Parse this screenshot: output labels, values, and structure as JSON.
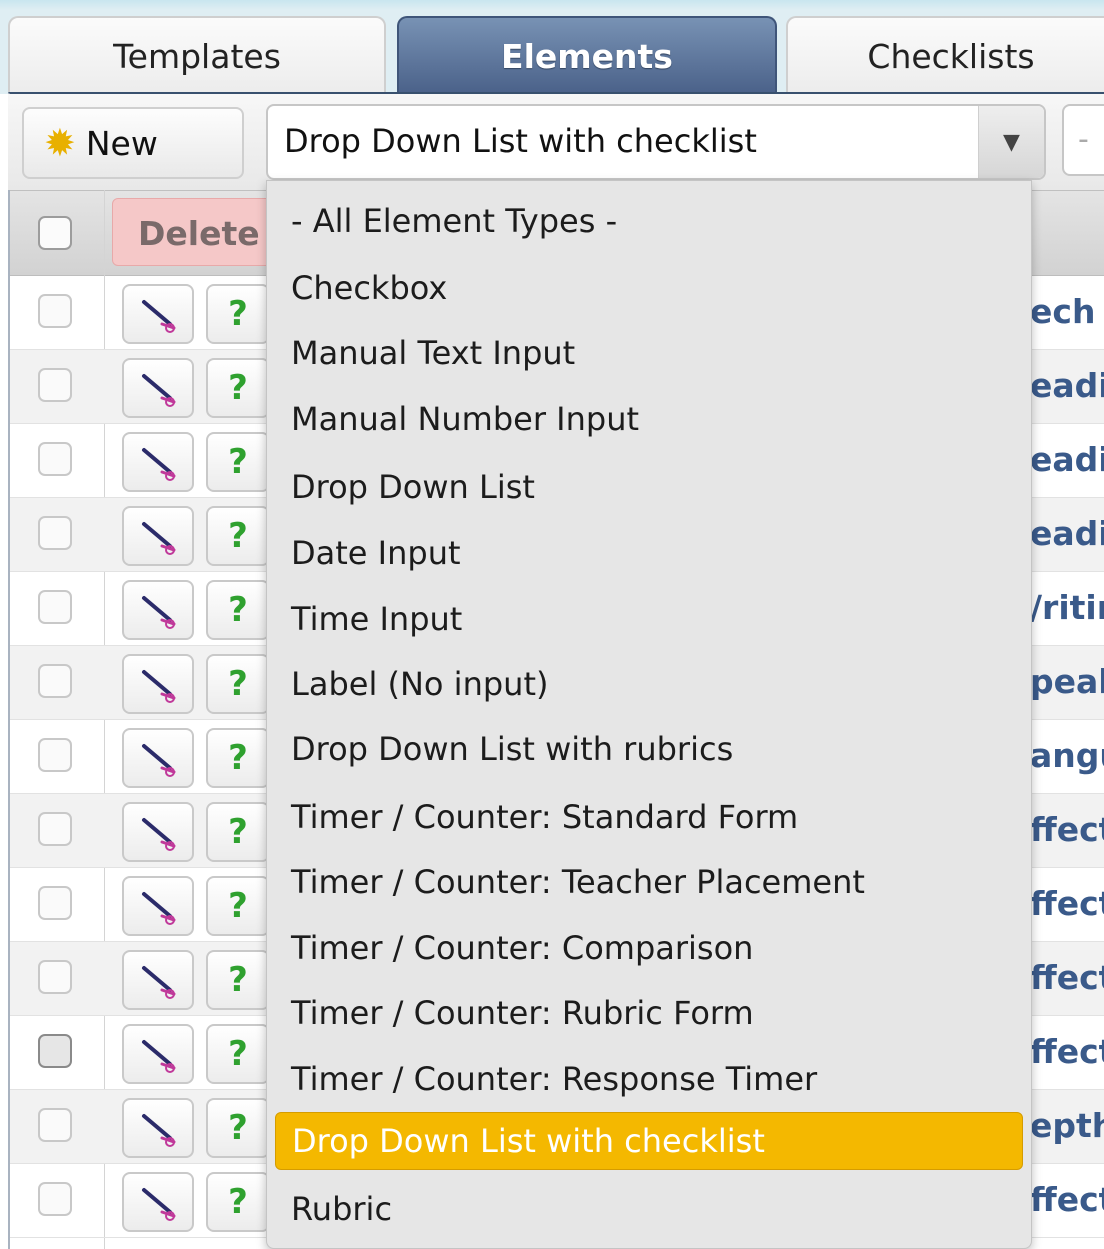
{
  "tabs": [
    {
      "label": "Templates"
    },
    {
      "label": "Elements"
    },
    {
      "label": "Checklists"
    }
  ],
  "toolbar": {
    "new_label": "New",
    "new_icon": "star-icon",
    "type_select_value": "Drop Down List with checklist",
    "second_select_value": "-"
  },
  "table": {
    "delete_label": "Delete",
    "rows": [
      {
        "name_fragment": "ech"
      },
      {
        "name_fragment": "eadi"
      },
      {
        "name_fragment": "eadi"
      },
      {
        "name_fragment": "eadi"
      },
      {
        "name_fragment": "/ritir"
      },
      {
        "name_fragment": "peal"
      },
      {
        "name_fragment": "angu"
      },
      {
        "name_fragment": "ffect"
      },
      {
        "name_fragment": "ffect"
      },
      {
        "name_fragment": "ffect"
      },
      {
        "name_fragment": "ffect"
      },
      {
        "name_fragment": "epth"
      },
      {
        "name_fragment": "ffect"
      }
    ],
    "help_symbol": "?"
  },
  "dropdown": {
    "options": [
      "- All Element Types -",
      "Checkbox",
      "Manual Text Input",
      "Manual Number Input",
      "Drop Down List",
      "Date Input",
      "Time Input",
      "Label (No input)",
      "Drop Down List with rubrics",
      "Timer / Counter: Standard Form",
      "Timer / Counter: Teacher Placement",
      "Timer / Counter: Comparison",
      "Timer / Counter: Rubric Form",
      "Timer / Counter: Response Timer",
      "Drop Down List with checklist",
      "Rubric"
    ],
    "selected": "Drop Down List with checklist",
    "highlight_color": "#f4b800"
  }
}
